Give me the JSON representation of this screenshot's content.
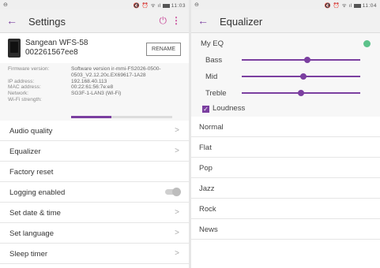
{
  "left": {
    "status": {
      "dot": "⊖",
      "icons": "🔇 ⏰ ᯤ ıl",
      "time": "11:03"
    },
    "appbar": {
      "back": "←",
      "title": "Settings",
      "power": "⏻",
      "more": "⋮"
    },
    "device": {
      "name_line1": "Sangean WFS-58",
      "name_line2": "002261567ee8",
      "rename_label": "RENAME"
    },
    "info": [
      {
        "key": "Firmware version:",
        "value": "Software version ir-mmi-FS2026-0500-0503_V2.12.20c.EX69617-1A28"
      },
      {
        "key": "IP address:",
        "value": "192.168.40.113"
      },
      {
        "key": "MAC address:",
        "value": "00:22:61:56:7e:e8"
      },
      {
        "key": "Network:",
        "value": "SG3F-1-LAN3 (Wi-Fi)"
      },
      {
        "key": "Wi-Fi strength:",
        "value": ""
      }
    ],
    "wifi_strength": 0.4,
    "menu": [
      {
        "label": "Audio quality",
        "type": "chevron"
      },
      {
        "label": "Equalizer",
        "type": "chevron"
      },
      {
        "label": "Factory reset",
        "type": "none"
      },
      {
        "label": "Logging enabled",
        "type": "toggle"
      },
      {
        "label": "Set date & time",
        "type": "chevron"
      },
      {
        "label": "Set language",
        "type": "chevron"
      },
      {
        "label": "Sleep timer",
        "type": "chevron"
      }
    ],
    "chevron": ">"
  },
  "right": {
    "status": {
      "dot": "⊖",
      "icons": "🔇 ⏰ ᯤ ıl",
      "time": "11:04"
    },
    "appbar": {
      "back": "←",
      "title": "Equalizer"
    },
    "myeq_label": "My EQ",
    "sliders": [
      {
        "label": "Bass",
        "value": 0.55
      },
      {
        "label": "Mid",
        "value": 0.52
      },
      {
        "label": "Treble",
        "value": 0.5
      }
    ],
    "loudness_label": "Loudness",
    "loudness_checked": true,
    "presets": [
      "Normal",
      "Flat",
      "Pop",
      "Jazz",
      "Rock",
      "News"
    ]
  },
  "colors": {
    "accent": "#7b3fa0",
    "pink": "#c94f9c",
    "green": "#5cc28a"
  }
}
